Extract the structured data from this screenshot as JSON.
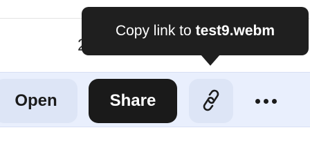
{
  "background_fragment": {
    "text": "2"
  },
  "tooltip": {
    "prefix": "Copy link to",
    "filename": "test9.webm"
  },
  "toolbar": {
    "open_label": "Open",
    "share_label": "Share",
    "link_icon": "link-icon",
    "more_icon": "more-horizontal-icon"
  },
  "colors": {
    "toolbar_bg": "#e9effd",
    "share_bg": "#1a1a1a",
    "secondary_btn_bg": "#dde5f6",
    "tooltip_bg": "#1f1f1f"
  }
}
